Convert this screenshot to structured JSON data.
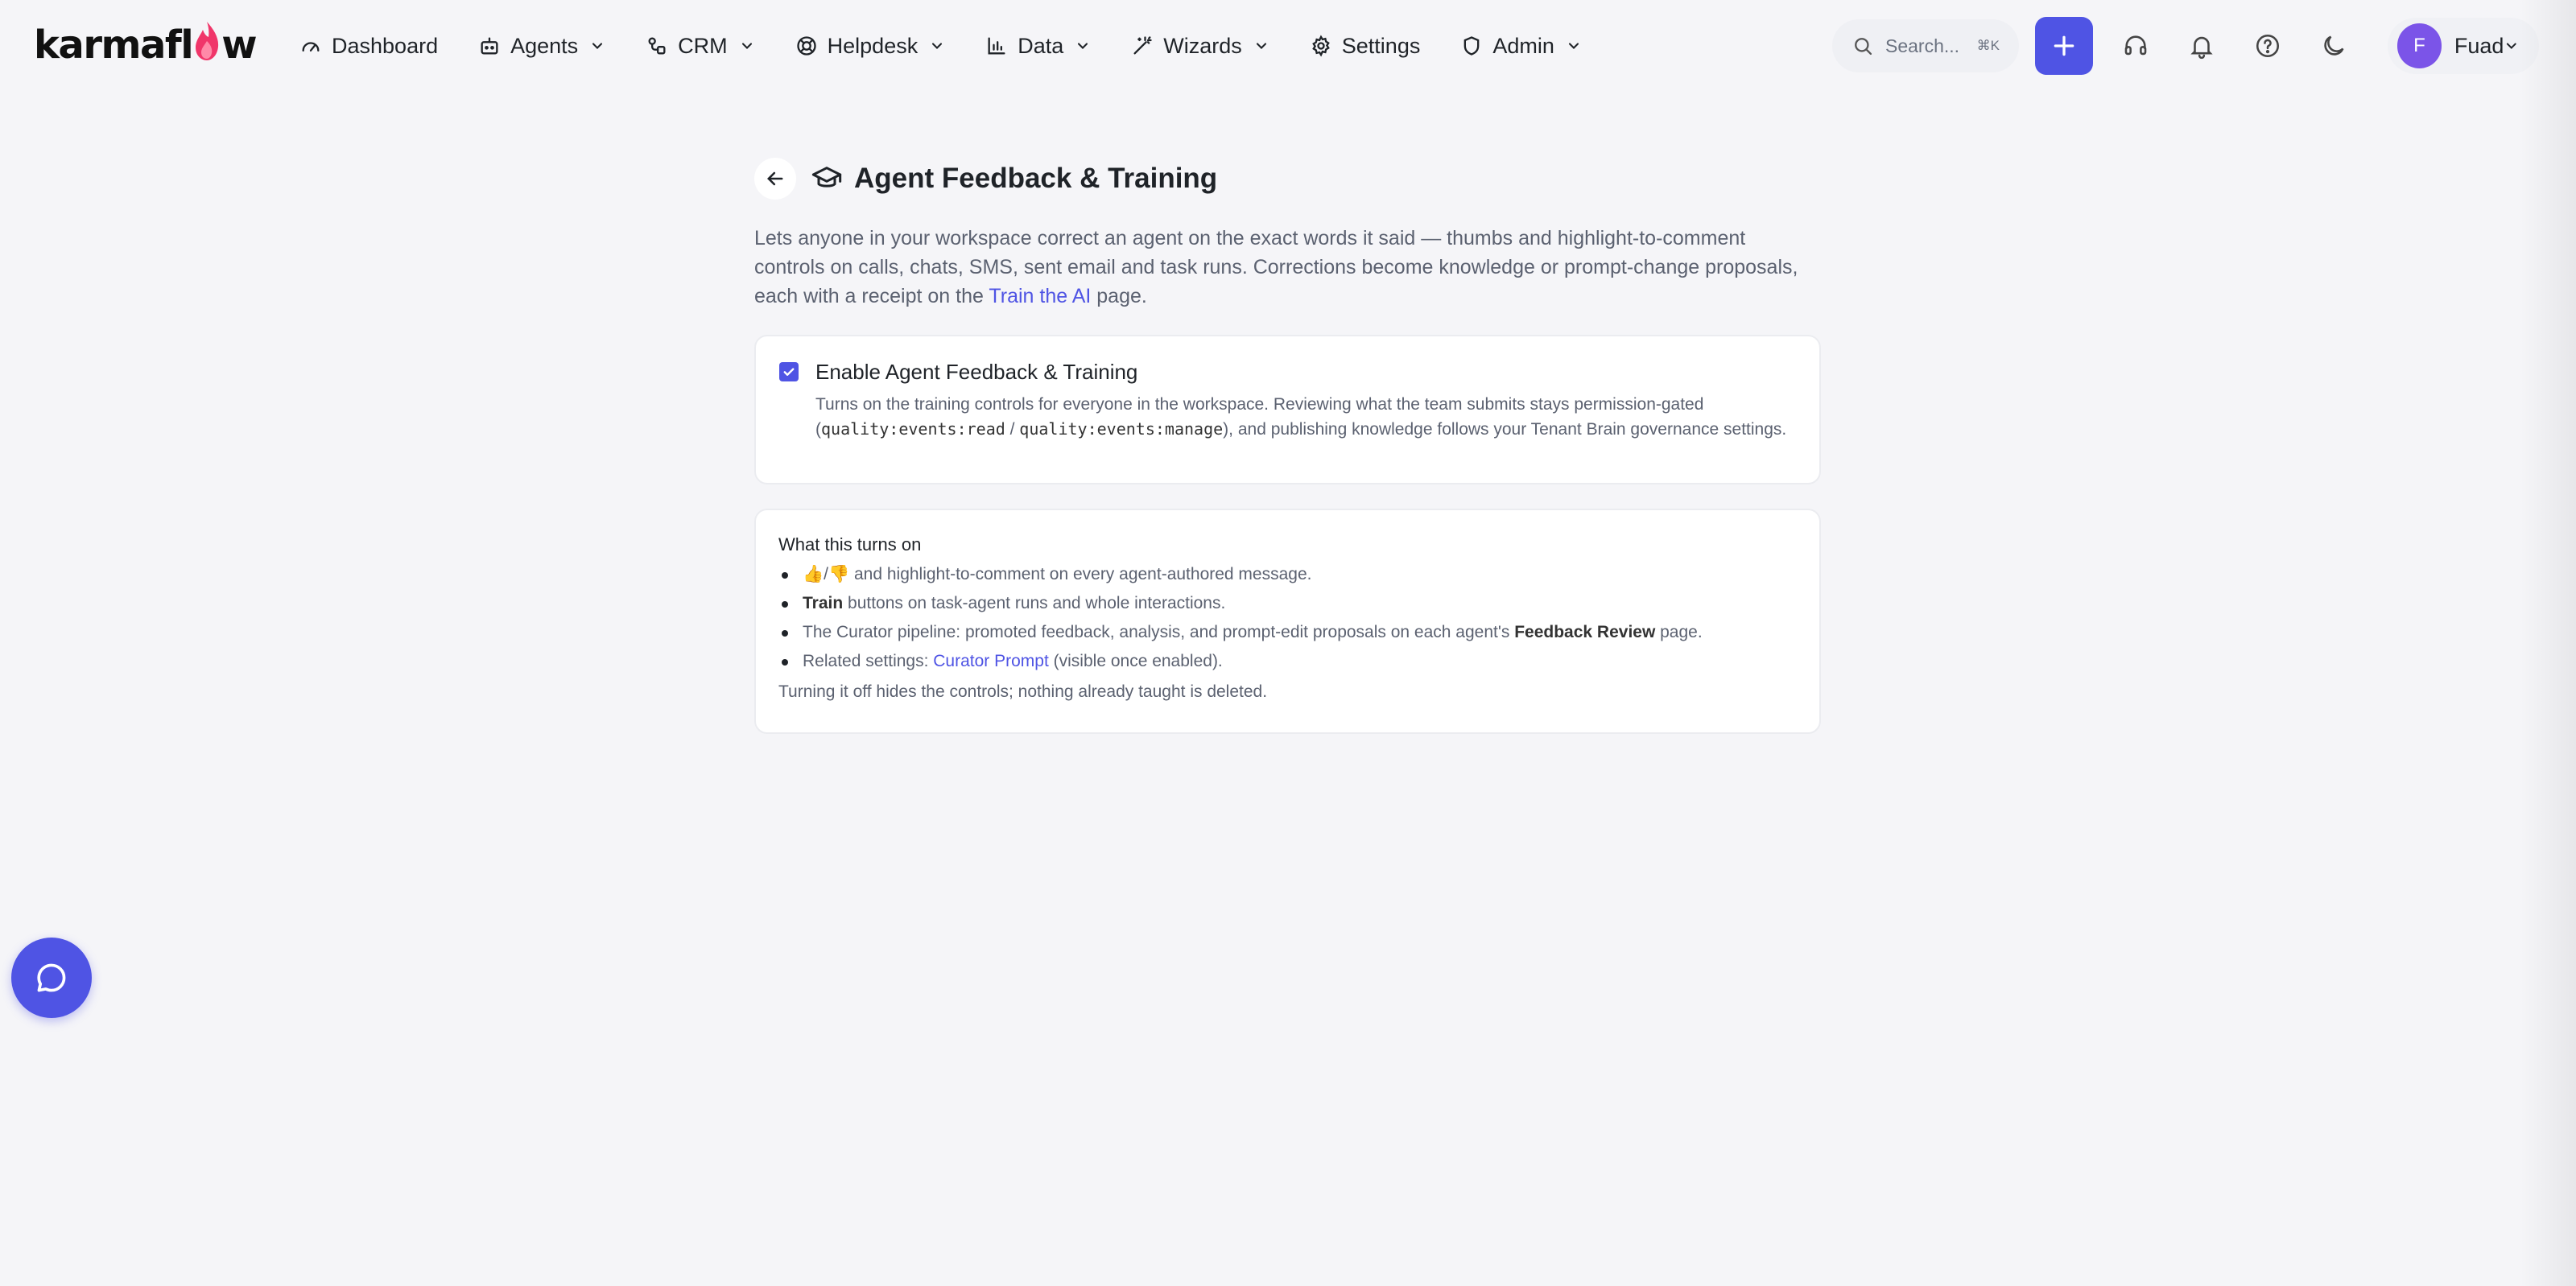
{
  "brand": {
    "logo_text_pre": "karmafl",
    "logo_text_post": "w",
    "accent": "#4f54e4"
  },
  "nav": {
    "items": [
      {
        "label": "Dashboard",
        "icon": "gauge-icon"
      },
      {
        "label": "Agents",
        "icon": "bot-icon"
      },
      {
        "label": "CRM",
        "icon": "crm-icon"
      },
      {
        "label": "Helpdesk",
        "icon": "lifebuoy-icon"
      },
      {
        "label": "Data",
        "icon": "bar-chart-icon"
      },
      {
        "label": "Wizards",
        "icon": "wand-icon"
      },
      {
        "label": "Settings",
        "icon": "gear-icon"
      },
      {
        "label": "Admin",
        "icon": "shield-icon"
      }
    ]
  },
  "search": {
    "placeholder": "Search...",
    "shortcut": "⌘K"
  },
  "user": {
    "initial": "F",
    "name": "Fuad"
  },
  "page": {
    "title": "Agent Feedback & Training",
    "intro_pre": "Lets anyone in your workspace correct an agent on the exact words it said — thumbs and highlight-to-comment controls on calls, chats, SMS, sent email and task runs. Corrections become knowledge or prompt-change proposals, each with a receipt on the ",
    "intro_link": "Train the AI",
    "intro_post": " page."
  },
  "enable": {
    "checked": true,
    "title": "Enable Agent Feedback & Training",
    "desc_pre": "Turns on the training controls for everyone in the workspace. Reviewing what the team submits stays permission-gated (",
    "code1": "quality:events:read",
    "desc_sep": " / ",
    "code2": "quality:events:manage",
    "desc_post": "), and publishing knowledge follows your Tenant Brain governance settings."
  },
  "info": {
    "heading": "What this turns on",
    "b1_emoji": "👍/👎",
    "b1_text": " and highlight-to-comment on every agent-authored message.",
    "b2_bold": "Train",
    "b2_text": " buttons on task-agent runs and whole interactions.",
    "b3_pre": "The Curator pipeline: promoted feedback, analysis, and prompt-edit proposals on each agent's ",
    "b3_bold": "Feedback Review",
    "b3_post": " page.",
    "b4_pre": "Related settings: ",
    "b4_link": "Curator Prompt",
    "b4_post": " (visible once enabled).",
    "footer": "Turning it off hides the controls; nothing already taught is deleted."
  }
}
